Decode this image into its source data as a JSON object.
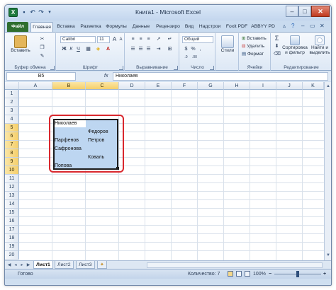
{
  "window": {
    "title": "Книга1 - Microsoft Excel"
  },
  "qat": {
    "save_icon": "save-icon",
    "undo_icon": "undo-icon",
    "redo_icon": "redo-icon"
  },
  "tabs": [
    "Файл",
    "Главная",
    "Вставка",
    "Разметка",
    "Формулы",
    "Данные",
    "Рецензиро",
    "Вид",
    "Надстрои",
    "Foxit PDF",
    "ABBYY PD"
  ],
  "ribbon": {
    "clipboard": {
      "paste": "Вставить",
      "label": "Буфер обмена"
    },
    "font": {
      "name": "Calibri",
      "size": "11",
      "bold": "Ж",
      "italic": "К",
      "underline": "Ч",
      "grow": "A",
      "shrink": "A",
      "label": "Шрифт"
    },
    "alignment": {
      "label": "Выравнивание"
    },
    "number": {
      "format": "Общий",
      "label": "Число"
    },
    "styles": {
      "button": "Стили"
    },
    "cells": {
      "insert": "Вставить",
      "delete": "Удалить",
      "format": "Формат",
      "label": "Ячейки"
    },
    "editing": {
      "sum": "Σ",
      "sort": "Сортировка и фильтр",
      "find": "Найти и выделить",
      "label": "Редактирование"
    }
  },
  "formula_bar": {
    "name_box": "B5",
    "fx": "fx",
    "content": "Николаев"
  },
  "grid": {
    "columns": [
      "A",
      "B",
      "C",
      "D",
      "E",
      "F",
      "G",
      "H",
      "I",
      "J",
      "K"
    ],
    "selected_columns": [
      "B",
      "C"
    ],
    "rows": [
      "1",
      "2",
      "3",
      "4",
      "5",
      "6",
      "7",
      "8",
      "9",
      "10",
      "11",
      "12",
      "13",
      "14",
      "15",
      "16",
      "17",
      "18",
      "19",
      "20"
    ],
    "selected_rows": [
      "5",
      "6",
      "7",
      "8",
      "9",
      "10"
    ],
    "cells": [
      {
        "ref": "B5",
        "value": "Николаев"
      },
      {
        "ref": "C6",
        "value": "Федоров"
      },
      {
        "ref": "B7",
        "value": "Парфенов"
      },
      {
        "ref": "C7",
        "value": "Петров"
      },
      {
        "ref": "B8",
        "value": "Сафронова"
      },
      {
        "ref": "C9",
        "value": "Коваль"
      },
      {
        "ref": "B10",
        "value": "Попова"
      }
    ]
  },
  "sheet_tabs": [
    "Лист1",
    "Лист2",
    "Лист3"
  ],
  "status": {
    "ready": "Готово",
    "count": "Количество: 7",
    "zoom": "100%"
  }
}
